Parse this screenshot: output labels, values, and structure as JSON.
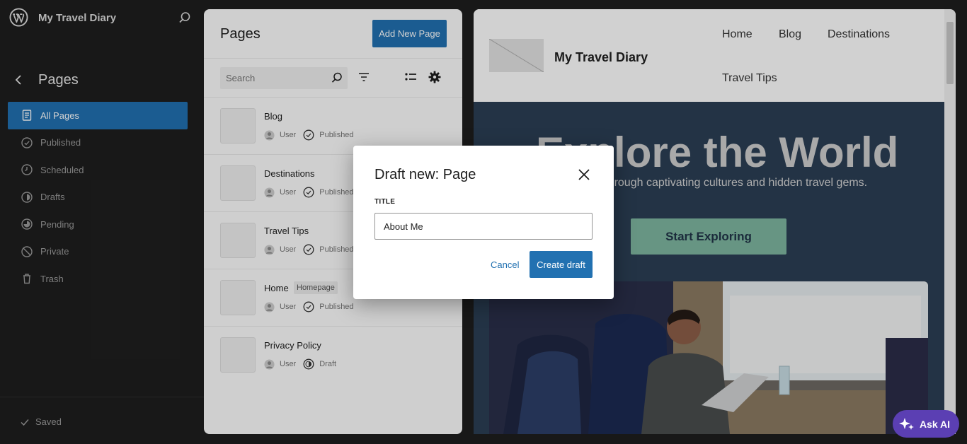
{
  "app": {
    "site_title": "My Travel Diary"
  },
  "sidebar": {
    "heading": "Pages",
    "items": [
      {
        "label": "All Pages",
        "icon": "pages-icon"
      },
      {
        "label": "Published",
        "icon": "published-icon"
      },
      {
        "label": "Scheduled",
        "icon": "scheduled-icon"
      },
      {
        "label": "Drafts",
        "icon": "drafts-icon"
      },
      {
        "label": "Pending",
        "icon": "pending-icon"
      },
      {
        "label": "Private",
        "icon": "private-icon"
      },
      {
        "label": "Trash",
        "icon": "trash-icon"
      }
    ],
    "saved_label": "Saved"
  },
  "pages_panel": {
    "title": "Pages",
    "add_button": "Add New Page",
    "search_placeholder": "Search",
    "rows": [
      {
        "name": "Blog",
        "author": "User",
        "status": "Published"
      },
      {
        "name": "Destinations",
        "author": "User",
        "status": "Published"
      },
      {
        "name": "Travel Tips",
        "author": "User",
        "status": "Published"
      },
      {
        "name": "Home",
        "badge": "Homepage",
        "author": "User",
        "status": "Published"
      },
      {
        "name": "Privacy Policy",
        "author": "User",
        "status": "Draft"
      }
    ]
  },
  "preview": {
    "site_title": "My Travel Diary",
    "nav": [
      "Home",
      "Blog",
      "Destinations",
      "Travel Tips"
    ],
    "hero_title": "Explore the World",
    "hero_subtitle": "Journey through captivating cultures and hidden travel gems.",
    "cta": "Start Exploring"
  },
  "modal": {
    "title": "Draft new: Page",
    "field_label": "TITLE",
    "title_value": "About Me",
    "cancel": "Cancel",
    "create": "Create draft"
  },
  "ask_ai": {
    "label": "Ask AI"
  },
  "colors": {
    "accent": "#2271b1",
    "sidebar_bg": "#1e1e1e",
    "hero_bg": "#2b3f55",
    "cta_bg": "#7eb6a0",
    "ask_ai_bg": "#5b3fb3"
  }
}
